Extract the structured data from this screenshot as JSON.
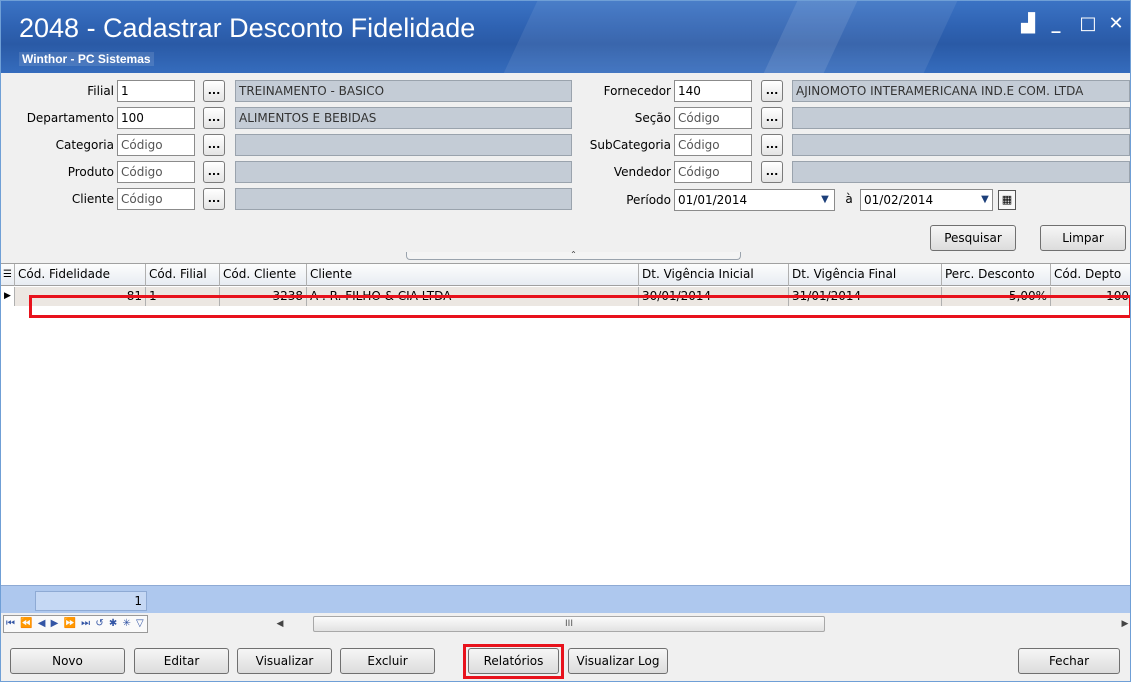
{
  "window": {
    "title": "2048 - Cadastrar Desconto Fidelidade",
    "subtitle": "Winthor - PC Sistemas",
    "controls": {
      "restore": "▟",
      "minimize": "_",
      "maximize": "□",
      "close": "✕"
    }
  },
  "filters": {
    "filial": {
      "label": "Filial",
      "code": "1",
      "description": "TREINAMENTO - BASICO"
    },
    "departamento": {
      "label": "Departamento",
      "code": "100",
      "description": "ALIMENTOS E BEBIDAS"
    },
    "categoria": {
      "label": "Categoria",
      "placeholder": "Código",
      "description": ""
    },
    "produto": {
      "label": "Produto",
      "placeholder": "Código",
      "description": ""
    },
    "cliente": {
      "label": "Cliente",
      "placeholder": "Código",
      "description": ""
    },
    "fornecedor": {
      "label": "Fornecedor",
      "code": "140",
      "description": "AJINOMOTO INTERAMERICANA IND.E COM. LTDA"
    },
    "secao": {
      "label": "Seção",
      "placeholder": "Código",
      "description": ""
    },
    "subcategoria": {
      "label": "SubCategoria",
      "placeholder": "Código",
      "description": ""
    },
    "vendedor": {
      "label": "Vendedor",
      "placeholder": "Código",
      "description": ""
    },
    "periodo": {
      "label": "Período",
      "from": "01/01/2014",
      "separator": "à",
      "to": "01/02/2014"
    },
    "lookup_glyph": "...",
    "search_button": "Pesquisar",
    "clear_button": "Limpar"
  },
  "grid": {
    "columns": [
      "Cód. Fidelidade",
      "Cód. Filial",
      "Cód. Cliente",
      "Cliente",
      "Dt. Vigência Inicial",
      "Dt. Vigência Final",
      "Perc. Desconto",
      "Cód. Depto"
    ],
    "rows": [
      {
        "cod_fidelidade": "81",
        "cod_filial": "1",
        "cod_cliente": "3238",
        "cliente": "A . R.  FILHO & CIA LTDA",
        "dt_inicial": "30/01/2014",
        "dt_final": "31/01/2014",
        "perc_desconto": "5,00%",
        "cod_depto": "100"
      }
    ],
    "record_count": "1"
  },
  "navigator": {
    "icons": "⏮ ⏪ ◀ ▶ ⏩ ⏭ ↺ ✱ ✳ ▽",
    "scroll_mark": "III"
  },
  "toolbar": {
    "novo": "Novo",
    "editar": "Editar",
    "visualizar": "Visualizar",
    "excluir": "Excluir",
    "relatorios": "Relatórios",
    "visualizar_log": "Visualizar Log",
    "fechar": "Fechar"
  },
  "colors": {
    "highlight": "#e8121c",
    "titlebar": "#2f63b3",
    "footer": "#aec8ee"
  }
}
